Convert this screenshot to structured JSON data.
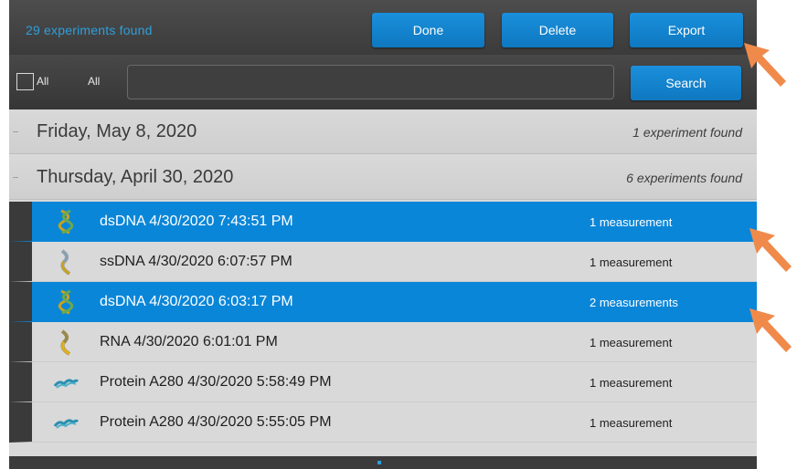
{
  "header": {
    "found_count": "29 experiments found",
    "done_label": "Done",
    "delete_label": "Delete",
    "export_label": "Export"
  },
  "filter": {
    "all_checkbox_label": "All",
    "all_filter_label": "All",
    "search_value": "",
    "search_label": "Search"
  },
  "groups": [
    {
      "date": "Friday, May 8, 2020",
      "count": "1 experiment found"
    },
    {
      "date": "Thursday, April 30, 2020",
      "count": "6 experiments found"
    }
  ],
  "experiments": [
    {
      "icon": "dsdna-icon",
      "name": "dsDNA 4/30/2020 7:43:51 PM",
      "measurements": "1 measurement",
      "selected": true
    },
    {
      "icon": "ssdna-icon",
      "name": "ssDNA 4/30/2020 6:07:57 PM",
      "measurements": "1 measurement",
      "selected": false
    },
    {
      "icon": "dsdna-icon",
      "name": "dsDNA 4/30/2020 6:03:17 PM",
      "measurements": "2 measurements",
      "selected": true
    },
    {
      "icon": "rna-icon",
      "name": "RNA 4/30/2020 6:01:01 PM",
      "measurements": "1 measurement",
      "selected": false
    },
    {
      "icon": "protein-icon",
      "name": "Protein A280 4/30/2020 5:58:49 PM",
      "measurements": "1 measurement",
      "selected": false
    },
    {
      "icon": "protein-icon",
      "name": "Protein A280 4/30/2020 5:55:05 PM",
      "measurements": "1 measurement",
      "selected": false
    }
  ],
  "colors": {
    "accent_blue": "#0a86d8",
    "header_dark": "#3b3b3b",
    "annotation_arrow": "#f08a4b"
  }
}
